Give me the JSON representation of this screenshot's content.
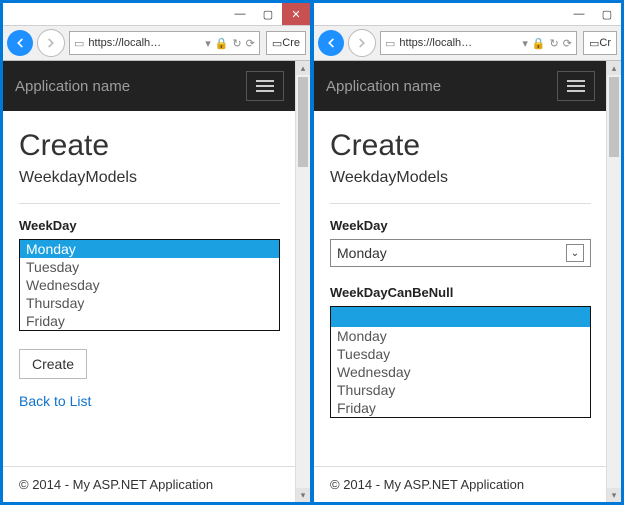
{
  "window": {
    "minimize_glyph": "—",
    "maximize_glyph": "▢",
    "close_glyph": "✕"
  },
  "toolbar": {
    "url_text": "https://localh…",
    "dropdown_glyph": "▾",
    "lock_glyph": "🔒",
    "refresh_glyph": "↻",
    "search_glyph": "⟳"
  },
  "tab_left": "Cre",
  "tab_right": "Cr",
  "appbar": {
    "title": "Application name"
  },
  "page": {
    "heading": "Create",
    "subheading": "WeekdayModels"
  },
  "left": {
    "label": "WeekDay",
    "options": [
      "Monday",
      "Tuesday",
      "Wednesday",
      "Thursday",
      "Friday"
    ],
    "selected_index": 0,
    "create_button": "Create",
    "back_link": "Back to List"
  },
  "right": {
    "label1": "WeekDay",
    "select_value": "Monday",
    "label2": "WeekDayCanBeNull",
    "options": [
      "Monday",
      "Tuesday",
      "Wednesday",
      "Thursday",
      "Friday"
    ],
    "blank_selected": true
  },
  "footer": "© 2014 - My ASP.NET Application"
}
